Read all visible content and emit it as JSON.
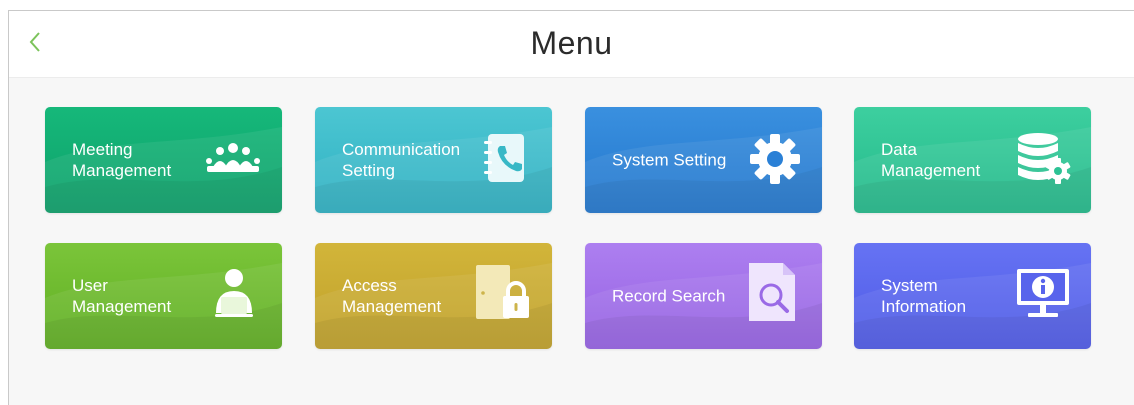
{
  "header": {
    "title": "Menu",
    "back_icon": "chevron-left-icon"
  },
  "tiles": [
    {
      "id": "meeting",
      "line1": "Meeting",
      "line2": "Management",
      "icon": "meeting-icon",
      "color_top": "#16b87a",
      "color_bottom": "#0ea06a"
    },
    {
      "id": "communication",
      "line1": "Communication",
      "line2": "Setting",
      "icon": "phone-book-icon",
      "color_top": "#4cc6d2",
      "color_bottom": "#2fb0c2"
    },
    {
      "id": "system-setting",
      "line1": "System Setting",
      "line2": "",
      "icon": "gear-icon",
      "color_top": "#3a90df",
      "color_bottom": "#2276cc"
    },
    {
      "id": "data",
      "line1": "Data",
      "line2": "Management",
      "icon": "database-gear-icon",
      "color_top": "#3dcf9f",
      "color_bottom": "#23b98a"
    },
    {
      "id": "user",
      "line1": "User",
      "line2": "Management",
      "icon": "user-computer-icon",
      "color_top": "#7bc53a",
      "color_bottom": "#5fae22"
    },
    {
      "id": "access",
      "line1": "Access",
      "line2": "Management",
      "icon": "door-lock-icon",
      "color_top": "#d2b53a",
      "color_bottom": "#bfa02a"
    },
    {
      "id": "record-search",
      "line1": "Record Search",
      "line2": "",
      "icon": "document-search-icon",
      "color_top": "#ad7ff0",
      "color_bottom": "#9561e2"
    },
    {
      "id": "system-info",
      "line1": "System",
      "line2": "Information",
      "icon": "monitor-info-icon",
      "color_top": "#6673f3",
      "color_bottom": "#4e5ae6"
    }
  ]
}
